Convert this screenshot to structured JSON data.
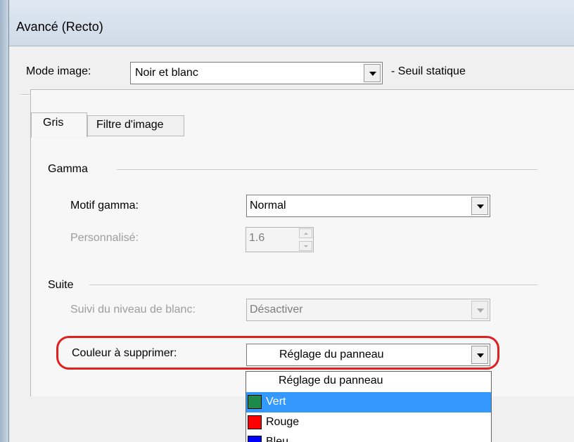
{
  "window": {
    "title": "Avancé (Recto)"
  },
  "image_mode": {
    "label": "Mode image:",
    "value": "Noir et blanc",
    "note": "- Seuil statique"
  },
  "tabs": [
    {
      "label": "Gris"
    },
    {
      "label": "Filtre d'image"
    }
  ],
  "gamma": {
    "section_label": "Gamma",
    "pattern_label": "Motif gamma:",
    "pattern_value": "Normal",
    "custom_label": "Personnalisé:",
    "custom_value": "1.6"
  },
  "suite": {
    "section_label": "Suite",
    "white_level_label": "Suivi du niveau de blanc:",
    "white_level_value": "Désactiver",
    "dropout_label": "Couleur à supprimer:",
    "dropout_value": "Réglage du panneau"
  },
  "dropout_options": [
    {
      "label": "Réglage du panneau",
      "swatch": null,
      "selected": false
    },
    {
      "label": "Vert",
      "swatch": "#1e8a4a",
      "selected": true
    },
    {
      "label": "Rouge",
      "swatch": "#ff0000",
      "selected": false
    },
    {
      "label": "Bleu",
      "swatch": "#0000ff",
      "selected": false
    }
  ],
  "colors": {
    "highlight": "#e0201d",
    "selection": "#3399ff"
  }
}
